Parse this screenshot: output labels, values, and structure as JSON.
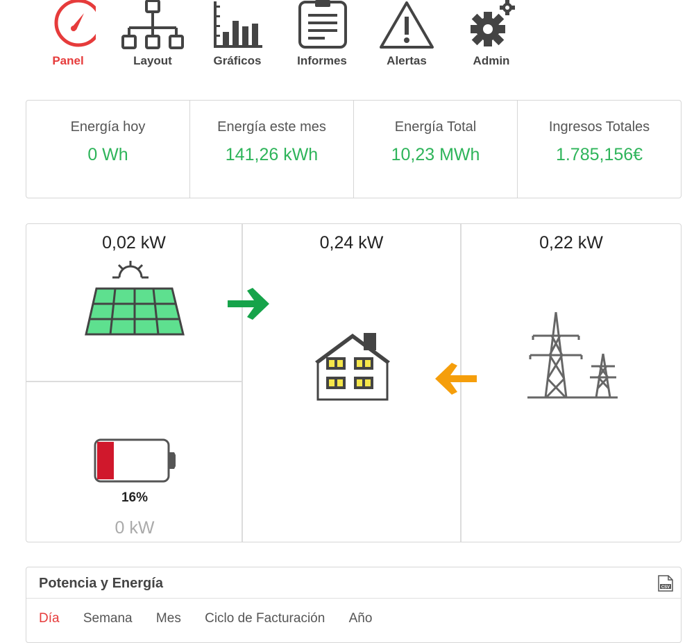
{
  "nav": {
    "items": [
      {
        "label": "Panel",
        "icon": "gauge-icon",
        "active": true
      },
      {
        "label": "Layout",
        "icon": "hierarchy-icon"
      },
      {
        "label": "Gráficos",
        "icon": "bar-chart-icon"
      },
      {
        "label": "Informes",
        "icon": "report-icon"
      },
      {
        "label": "Alertas",
        "icon": "warning-icon"
      },
      {
        "label": "Admin",
        "icon": "gears-icon"
      }
    ]
  },
  "stats": [
    {
      "title": "Energía hoy",
      "value": "0 Wh"
    },
    {
      "title": "Energía este mes",
      "value": "141,26 kWh"
    },
    {
      "title": "Energía Total",
      "value": "10,23 MWh"
    },
    {
      "title": "Ingresos Totales",
      "value": "1.785,156€"
    }
  ],
  "flow": {
    "solar_kw": "0,02 kW",
    "house_kw": "0,24 kW",
    "grid_kw": "0,22 kW",
    "battery_percent_label": "16%",
    "battery_level": 0.16,
    "battery_kw": "0 kW"
  },
  "power_energy": {
    "title": "Potencia y Energía",
    "tabs": [
      "Día",
      "Semana",
      "Mes",
      "Ciclo de Facturación",
      "Año"
    ],
    "active_tab": "Día"
  },
  "colors": {
    "accent_red": "#e63b3b",
    "green": "#2eb45a",
    "solar_green": "#5ee08f",
    "arrow_green": "#16a34a",
    "arrow_orange": "#f59e0b",
    "battery_red": "#d0182c",
    "window_yellow": "#f5e64a"
  }
}
